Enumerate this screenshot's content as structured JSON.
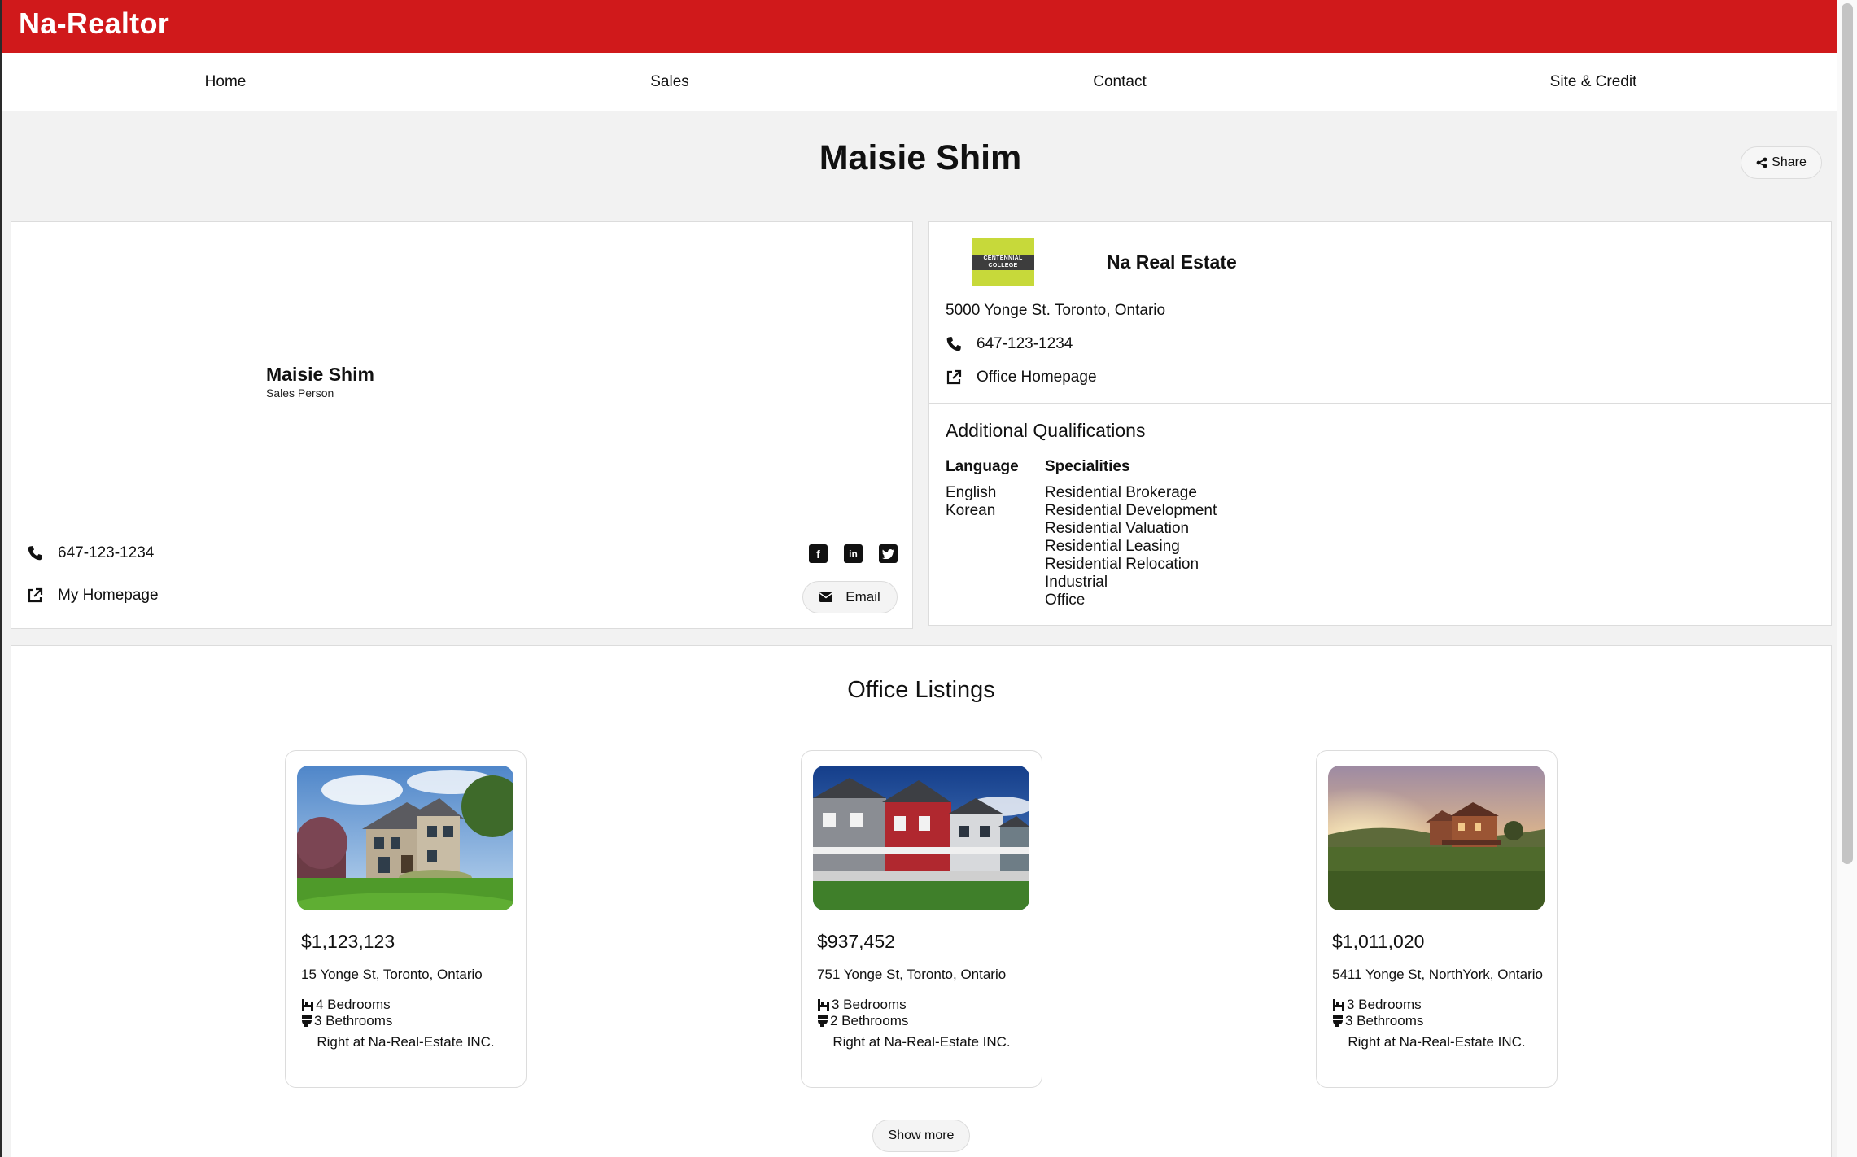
{
  "header": {
    "brand": "Na-Realtor",
    "brand_color": "#d0191b"
  },
  "nav": {
    "items": [
      {
        "label": "Home"
      },
      {
        "label": "Sales"
      },
      {
        "label": "Contact"
      },
      {
        "label": "Site & Credit"
      }
    ]
  },
  "page": {
    "title": "Maisie Shim",
    "share_label": "Share",
    "share_icon": "share-icon"
  },
  "agent": {
    "name": "Maisie Shim",
    "role": "Sales Person",
    "phone": "647-123-1234",
    "homepage_label": "My Homepage",
    "email_label": "Email",
    "social_icons": [
      "facebook-icon",
      "linkedin-icon",
      "twitter-icon"
    ]
  },
  "office": {
    "logo_text": "CENTENNIAL COLLEGE",
    "name": "Na Real Estate",
    "address": "5000 Yonge St. Toronto, Ontario",
    "phone": "647-123-1234",
    "homepage_label": "Office Homepage"
  },
  "qualifications": {
    "title": "Additional Qualifications",
    "language_header": "Language",
    "languages": [
      "English",
      "Korean"
    ],
    "specialities_header": "Specialities",
    "specialities": [
      "Residential Brokerage",
      "Residential Development",
      "Residential Valuation",
      "Residential Leasing",
      "Residential Relocation",
      "Industrial",
      "Office"
    ]
  },
  "listings": {
    "title": "Office Listings",
    "show_more_label": "Show more",
    "items": [
      {
        "price": "$1,123,123",
        "address": "15 Yonge St, Toronto, Ontario",
        "bedrooms": "4 Bedrooms",
        "bathrooms": "3 Bethrooms",
        "brokerage": "Right at Na-Real-Estate INC."
      },
      {
        "price": "$937,452",
        "address": "751 Yonge St, Toronto, Ontario",
        "bedrooms": "3 Bedrooms",
        "bathrooms": "2 Bethrooms",
        "brokerage": "Right at Na-Real-Estate INC."
      },
      {
        "price": "$1,011,020",
        "address": "5411 Yonge St, NorthYork, Ontario",
        "bedrooms": "3 Bedrooms",
        "bathrooms": "3 Bethrooms",
        "brokerage": "Right at Na-Real-Estate INC."
      }
    ]
  }
}
